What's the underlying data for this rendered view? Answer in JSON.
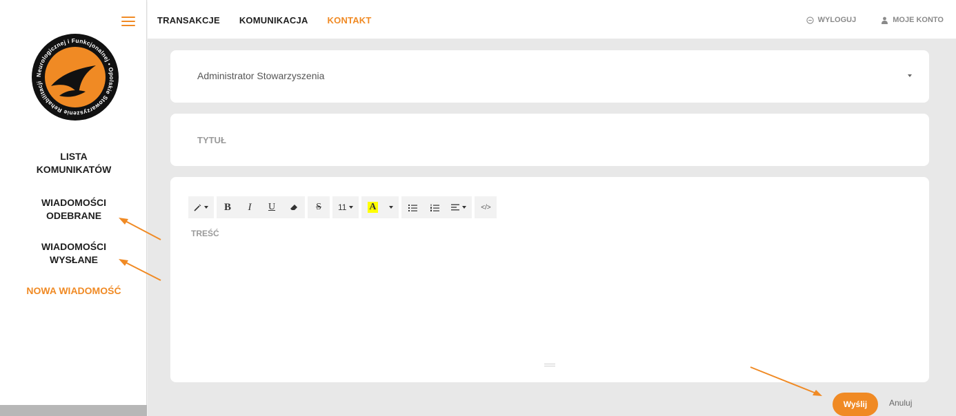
{
  "app": {
    "logo": {
      "ring_text": "Neurologicznej i Funkcjonalnej • Opolskie Stowarzyszenie Rehabilitacji"
    },
    "sidebar": {
      "items": [
        {
          "label": "LISTA KOMUNIKATÓW",
          "active": false
        },
        {
          "label": "WIADOMOŚCI ODEBRANE",
          "active": false
        },
        {
          "label": "WIADOMOŚCI WYSŁANE",
          "active": false
        },
        {
          "label": "NOWA WIADOMOŚĆ",
          "active": true
        }
      ]
    },
    "topnav": {
      "items": [
        {
          "label": "TRANSAKCJE",
          "active": false
        },
        {
          "label": "KOMUNIKACJA",
          "active": false
        },
        {
          "label": "KONTAKT",
          "active": true
        }
      ],
      "right": {
        "logout_label": "WYLOGUJ",
        "account_label": "MOJE KONTO"
      }
    },
    "form": {
      "recipient": "Administrator Stowarzyszenia",
      "title_placeholder": "TYTUŁ",
      "body_placeholder": "TREŚĆ",
      "toolbar": {
        "font_size": "11",
        "bold": "B",
        "italic": "I",
        "underline": "U",
        "strike": "S",
        "color": "A",
        "code": "</>"
      },
      "send_label": "Wyślij",
      "cancel_label": "Anuluj"
    },
    "colors": {
      "accent": "#f08a24",
      "background": "#e8e8e8",
      "text_dark": "#1e1e1e",
      "muted": "#8a8a8a"
    }
  }
}
